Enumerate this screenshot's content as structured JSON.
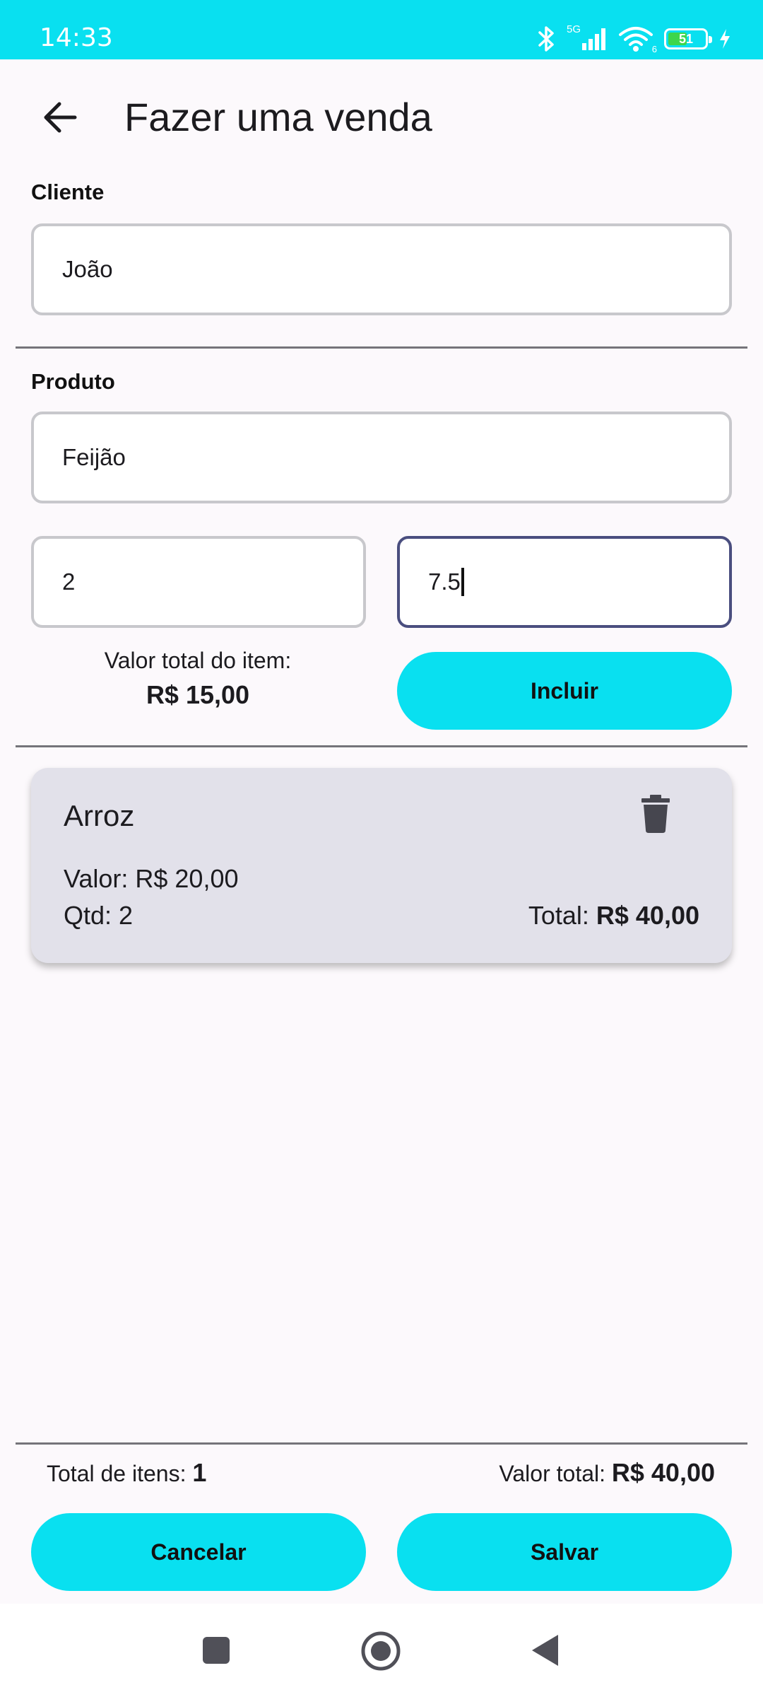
{
  "status_bar": {
    "time": "14:33",
    "network": "5G",
    "wifi_badge": "6",
    "battery": "51",
    "icons": [
      "bluetooth-icon",
      "signal-icon",
      "wifi-icon",
      "battery-icon",
      "charging-icon"
    ]
  },
  "app_bar": {
    "title": "Fazer uma venda",
    "back_icon": "arrow-back-icon"
  },
  "form": {
    "client_label": "Cliente",
    "client_value": "João",
    "product_label": "Produto",
    "product_value": "Feijão",
    "quantity_value": "2",
    "price_value": "7.5",
    "item_total_label": "Valor total do item:",
    "item_total_value": "R$ 15,00",
    "add_button": "Incluir"
  },
  "items": [
    {
      "name": "Arroz",
      "price_label": "Valor:",
      "price": "R$ 20,00",
      "qty_label": "Qtd:",
      "qty": "2",
      "total_label": "Total:",
      "total": "R$ 40,00",
      "delete_icon": "trash-icon"
    }
  ],
  "footer": {
    "items_count_label": "Total de itens:",
    "items_count": "1",
    "total_label": "Valor total:",
    "total_value": "R$ 40,00",
    "cancel_button": "Cancelar",
    "save_button": "Salvar"
  },
  "nav": {
    "icons": [
      "recents-icon",
      "home-icon",
      "back-triangle-icon"
    ]
  },
  "colors": {
    "accent": "#09e0f0",
    "background": "#fcf9fc",
    "card": "#e2e1ea",
    "focus_border": "#4a4e7f"
  }
}
